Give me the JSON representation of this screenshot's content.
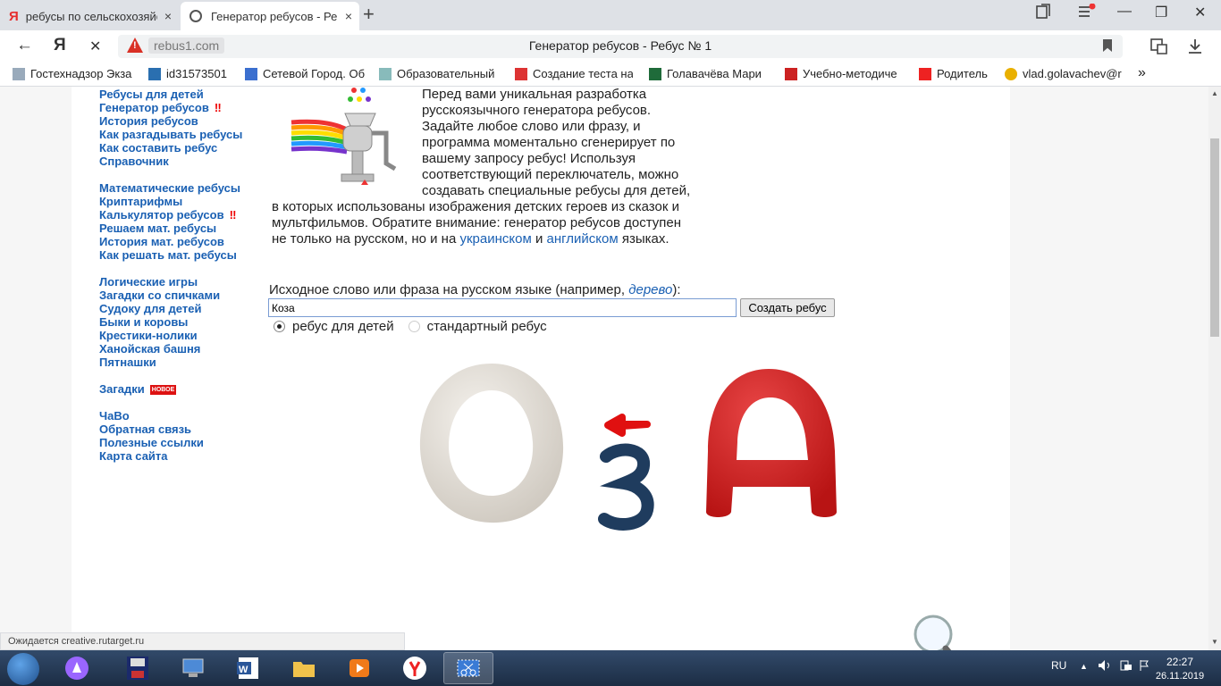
{
  "tabs": [
    {
      "label": "ребусы по сельскохозяйст",
      "icon": "yandex-icon",
      "close": "×"
    },
    {
      "label": "Генератор ребусов - Ре",
      "icon": "loading-icon",
      "close": "×"
    }
  ],
  "new_tab": "+",
  "window_controls": {
    "minimize": "—",
    "restore": "❐",
    "close": "✕"
  },
  "toolbar": {
    "back": "←",
    "yandex": "Я",
    "stop": "✕",
    "domain": "rebus1.com",
    "page_title": "Генератор ребусов - Ребус № 1"
  },
  "bookmarks": [
    "Гостехнадзор Экза",
    "id31573501",
    "Сетевой Город. Об",
    "Образовательный",
    "Создание теста на",
    "Голавачёва Мари",
    "Учебно-методиче",
    "Родитель",
    "vlad.golavachev@r"
  ],
  "bookmarks_more": "»",
  "sidebar": {
    "group1": [
      "Ребусы для детей",
      "Генератор ребусов",
      "История ребусов",
      "Как разгадывать ребусы",
      "Как составить ребус",
      "Справочник"
    ],
    "group2": [
      "Математические ребусы",
      "Криптарифмы",
      "Калькулятор ребусов",
      "Решаем мат. ребусы",
      "История мат. ребусов",
      "Как решать мат. ребусы"
    ],
    "group3": [
      "Логические игры",
      "Загадки со спичками",
      "Судоку для детей",
      "Быки и коровы",
      "Крестики-нолики",
      "Ханойская башня",
      "Пятнашки"
    ],
    "riddles": "Загадки",
    "new_badge": "НОВОЕ",
    "group5": [
      "ЧаВо",
      "Обратная связь",
      "Полезные ссылки",
      "Карта сайта"
    ],
    "excl": "‼"
  },
  "intro": {
    "part1": "Перед вами уникальная разработка русскоязычного генератора ребусов. Задайте любое слово или фразу, и программа моментально сгенерирует по вашему запросу ребус! Используя соответствующий переключатель, можно создавать специальные ребусы для детей, в которых использованы изображения детских героев из сказок и мультфильмов. Обратите внимание: генератор ребусов доступен не только на русском, но и на",
    "link_ua": "украинском",
    "and": "и",
    "link_en": "английском",
    "part2": "языках."
  },
  "form": {
    "label_prefix": "Исходное слово или фраза на русском языке (например,",
    "example": "дерево",
    "label_suffix": "):",
    "value": "Коза",
    "submit": "Создать ребус",
    "radio_kids": "ребус для детей",
    "radio_standard": "стандартный ребус",
    "selected": "kids"
  },
  "rebus": {
    "letters": [
      "О",
      "З",
      "А"
    ],
    "arrow": "left"
  },
  "status_text": "Ожидается creative.rutarget.ru",
  "tray": {
    "lang": "RU",
    "time": "22:27",
    "date": "26.11.2019"
  },
  "colors": {
    "link": "#1a60b3",
    "accent_red": "#e00000",
    "tab_bg": "#dee1e6",
    "taskbar": "#1c2d44"
  }
}
